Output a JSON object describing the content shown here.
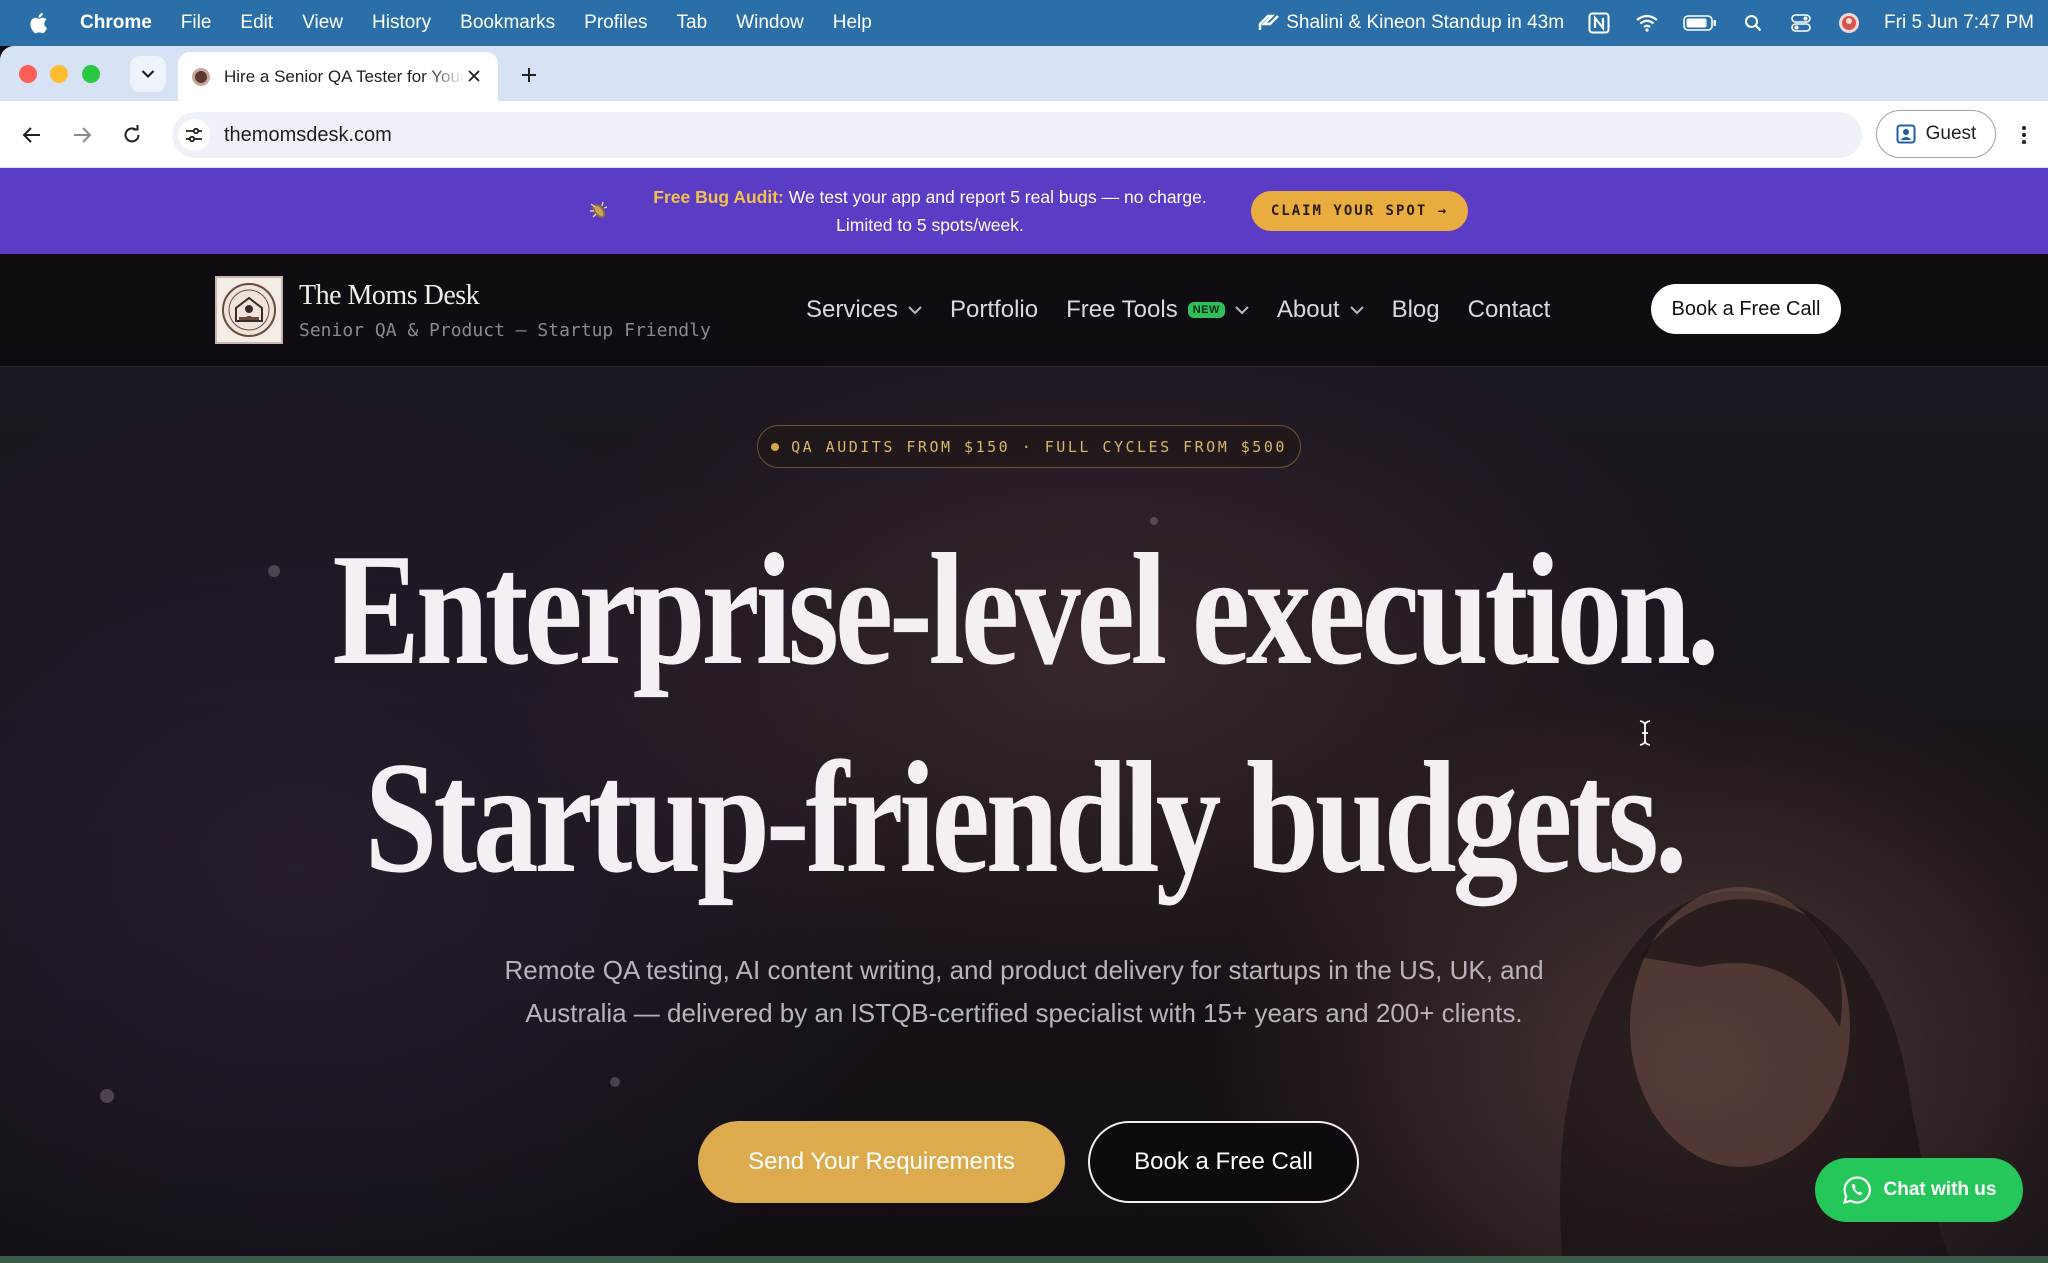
{
  "menubar": {
    "app": "Chrome",
    "items": [
      "File",
      "Edit",
      "View",
      "History",
      "Bookmarks",
      "Profiles",
      "Tab",
      "Window",
      "Help"
    ],
    "meeting": "Shalini & Kineon Standup in 43m",
    "datetime": "Fri 5 Jun  7:47 PM"
  },
  "browser": {
    "tab_title": "Hire a Senior QA Tester for Your Startup",
    "url": "themomsdesk.com",
    "profile_label": "Guest"
  },
  "promo": {
    "highlight": "Free Bug Audit:",
    "message": " We test your app and report 5 real bugs — no charge.",
    "message_line2": "Limited to 5 spots/week.",
    "cta": "CLAIM YOUR SPOT →"
  },
  "header": {
    "brand_name": "The Moms Desk",
    "tagline": "Senior QA & Product — Startup Friendly",
    "nav": [
      {
        "label": "Services",
        "dropdown": true
      },
      {
        "label": "Portfolio"
      },
      {
        "label": "Free Tools",
        "badge": "NEW",
        "dropdown": true
      },
      {
        "label": "About",
        "dropdown": true
      },
      {
        "label": "Blog"
      },
      {
        "label": "Contact"
      }
    ],
    "cta": "Book a Free Call"
  },
  "hero": {
    "pill": "QA AUDITS FROM $150 · FULL CYCLES FROM $500",
    "headline_line1": "Enterprise-level execution.",
    "headline_line2": "Startup-friendly budgets.",
    "subcopy": "Remote QA testing, AI content writing, and product delivery for startups in the US, UK, and Australia — delivered by an ISTQB-certified specialist with 15+ years and 200+ clients.",
    "primary_cta": "Send Your Requirements",
    "secondary_cta": "Book a Free Call"
  },
  "chat_widget": {
    "label": "Chat with us"
  },
  "colors": {
    "menubar": "#2b6fa8",
    "promo_bg": "#5b3cc4",
    "accent_gold": "#dcab4e",
    "chat_green": "#25c65a"
  }
}
